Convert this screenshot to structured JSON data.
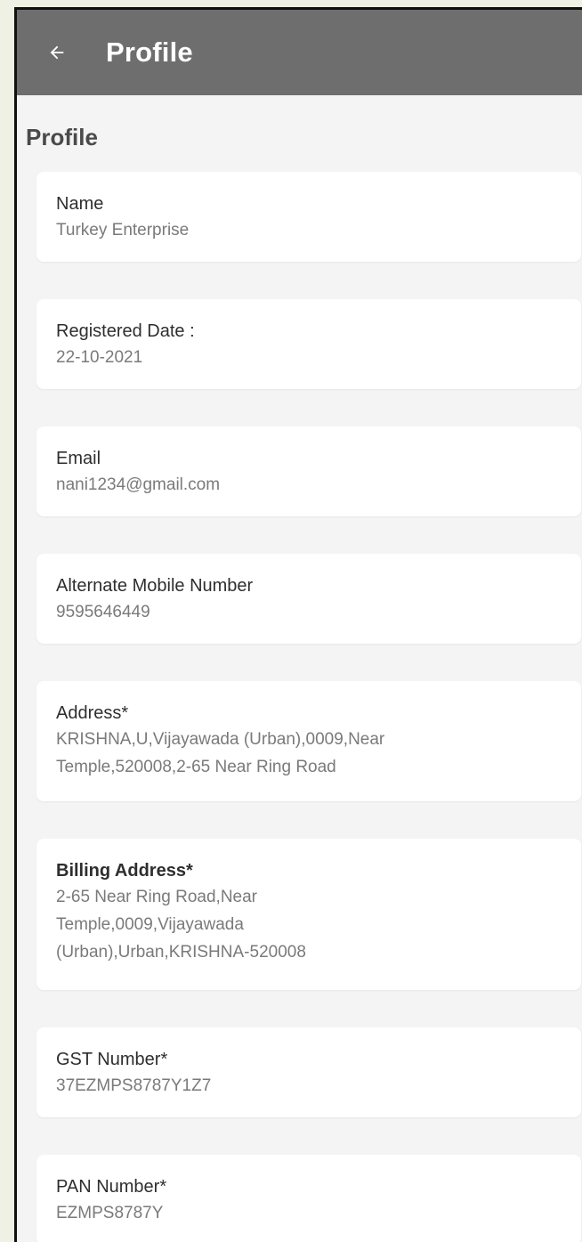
{
  "appbar": {
    "title": "Profile"
  },
  "section_title": "Profile",
  "fields": [
    {
      "label": "Name",
      "value": "Turkey Enterprise"
    },
    {
      "label": "Registered Date :",
      "value": "22-10-2021"
    },
    {
      "label": "Email",
      "value": "nani1234@gmail.com"
    },
    {
      "label": "Alternate Mobile Number",
      "value": "9595646449"
    },
    {
      "label": "Address*",
      "value_lines": [
        "KRISHNA,U,Vijayawada (Urban),0009,Near",
        "Temple,520008,2-65 Near Ring Road"
      ]
    },
    {
      "label": "Billing Address*",
      "value_lines": [
        "2-65 Near Ring Road,Near",
        "Temple,0009,Vijayawada",
        "(Urban),Urban,KRISHNA-520008"
      ]
    },
    {
      "label": "GST Number*",
      "value": "37EZMPS8787Y1Z7"
    },
    {
      "label": "PAN Number*",
      "value": "EZMPS8787Y"
    }
  ],
  "colors": {
    "appbar": "#6e6e6e",
    "background": "#f4f4f4",
    "card": "#ffffff"
  }
}
